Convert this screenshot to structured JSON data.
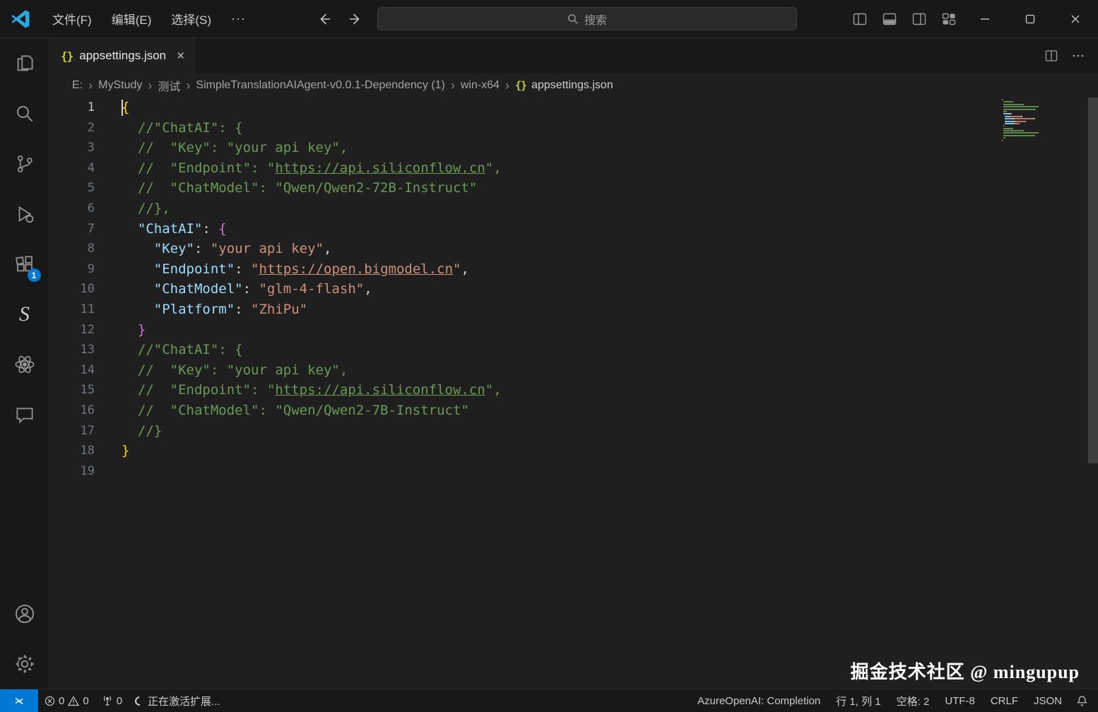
{
  "titlebar": {
    "menus": [
      "文件(F)",
      "编辑(E)",
      "选择(S)"
    ],
    "overflow": "···",
    "search_placeholder": "搜索"
  },
  "tab": {
    "label": "appsettings.json",
    "close_glyph": "×",
    "json_icon_glyph": "{}"
  },
  "breadcrumb": {
    "items": [
      "E:",
      "MyStudy",
      "测试",
      "SimpleTranslationAIAgent-v0.0.1-Dependency (1)",
      "win-x64",
      "appsettings.json"
    ]
  },
  "editor": {
    "language": "JSON",
    "cursor": {
      "line": 1,
      "col": 1
    },
    "lines": [
      [
        [
          "b1",
          "{"
        ]
      ],
      [
        [
          "c",
          "  //\"ChatAI\": {"
        ]
      ],
      [
        [
          "c",
          "  //  \"Key\": \"your api key\","
        ]
      ],
      [
        [
          "c",
          "  //  \"Endpoint\": \""
        ],
        [
          "cu",
          "https://api.siliconflow.cn"
        ],
        [
          "c",
          "\","
        ]
      ],
      [
        [
          "c",
          "  //  \"ChatModel\": \"Qwen/Qwen2-72B-Instruct\""
        ]
      ],
      [
        [
          "c",
          "  //},"
        ]
      ],
      [
        [
          "k",
          "  \"ChatAI\""
        ],
        [
          "p",
          ": "
        ],
        [
          "b2",
          "{"
        ]
      ],
      [
        [
          "k",
          "    \"Key\""
        ],
        [
          "p",
          ": "
        ],
        [
          "s",
          "\"your api key\""
        ],
        [
          "p",
          ","
        ]
      ],
      [
        [
          "k",
          "    \"Endpoint\""
        ],
        [
          "p",
          ": "
        ],
        [
          "s",
          "\""
        ],
        [
          "su",
          "https://open.bigmodel.cn"
        ],
        [
          "s",
          "\""
        ],
        [
          "p",
          ","
        ]
      ],
      [
        [
          "k",
          "    \"ChatModel\""
        ],
        [
          "p",
          ": "
        ],
        [
          "s",
          "\"glm-4-flash\""
        ],
        [
          "p",
          ","
        ]
      ],
      [
        [
          "k",
          "    \"Platform\""
        ],
        [
          "p",
          ": "
        ],
        [
          "s",
          "\"ZhiPu\""
        ]
      ],
      [
        [
          "b2",
          "  }"
        ]
      ],
      [
        [
          "c",
          "  //\"ChatAI\": {"
        ]
      ],
      [
        [
          "c",
          "  //  \"Key\": \"your api key\","
        ]
      ],
      [
        [
          "c",
          "  //  \"Endpoint\": \""
        ],
        [
          "cu",
          "https://api.siliconflow.cn"
        ],
        [
          "c",
          "\","
        ]
      ],
      [
        [
          "c",
          "  //  \"ChatModel\": \"Qwen/Qwen2-7B-Instruct\""
        ]
      ],
      [
        [
          "c",
          "  //}"
        ]
      ],
      [
        [
          "b1",
          "}"
        ]
      ],
      []
    ]
  },
  "activity_bar": {
    "extensions_badge": "1",
    "s_extension_glyph": "S"
  },
  "status_bar": {
    "remote_glyph": "><",
    "errors": "0",
    "warnings": "0",
    "ports": "0",
    "message": "正在激活扩展...",
    "right_items": [
      "AzureOpenAI: Completion",
      "行 1, 列 1",
      "空格: 2",
      "UTF-8",
      "CRLF",
      "JSON"
    ]
  },
  "watermark": "掘金技术社区 @ mingupup",
  "colors": {
    "accent": "#0078d4",
    "comment": "#6a9955",
    "key": "#9cdcfe",
    "string": "#ce9178",
    "brace_outer": "#ffd700",
    "brace_inner": "#da70d6",
    "json_icon": "#cbcb41"
  }
}
